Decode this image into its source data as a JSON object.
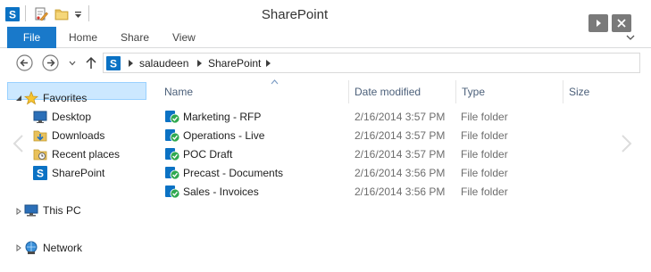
{
  "window": {
    "title": "SharePoint"
  },
  "ribbon": {
    "tabs": [
      "File",
      "Home",
      "Share",
      "View"
    ]
  },
  "address": {
    "crumbs": [
      "salaudeen",
      "SharePoint"
    ]
  },
  "nav": {
    "favorites": "Favorites",
    "items": [
      "Desktop",
      "Downloads",
      "Recent places",
      "SharePoint"
    ],
    "this_pc": "This PC",
    "network": "Network",
    "selected": "SharePoint"
  },
  "columns": {
    "name": "Name",
    "date": "Date modified",
    "type": "Type",
    "size": "Size"
  },
  "rows": [
    {
      "name": "Marketing - RFP",
      "date": "2/16/2014 3:57 PM",
      "type": "File folder"
    },
    {
      "name": "Operations - Live",
      "date": "2/16/2014 3:57 PM",
      "type": "File folder"
    },
    {
      "name": "POC Draft",
      "date": "2/16/2014 3:57 PM",
      "type": "File folder"
    },
    {
      "name": "Precast - Documents",
      "date": "2/16/2014 3:56 PM",
      "type": "File folder"
    },
    {
      "name": "Sales - Invoices",
      "date": "2/16/2014 3:56 PM",
      "type": "File folder"
    }
  ],
  "colors": {
    "accent": "#1979ca",
    "selection": "#cce8ff",
    "header_text": "#4c607a"
  }
}
